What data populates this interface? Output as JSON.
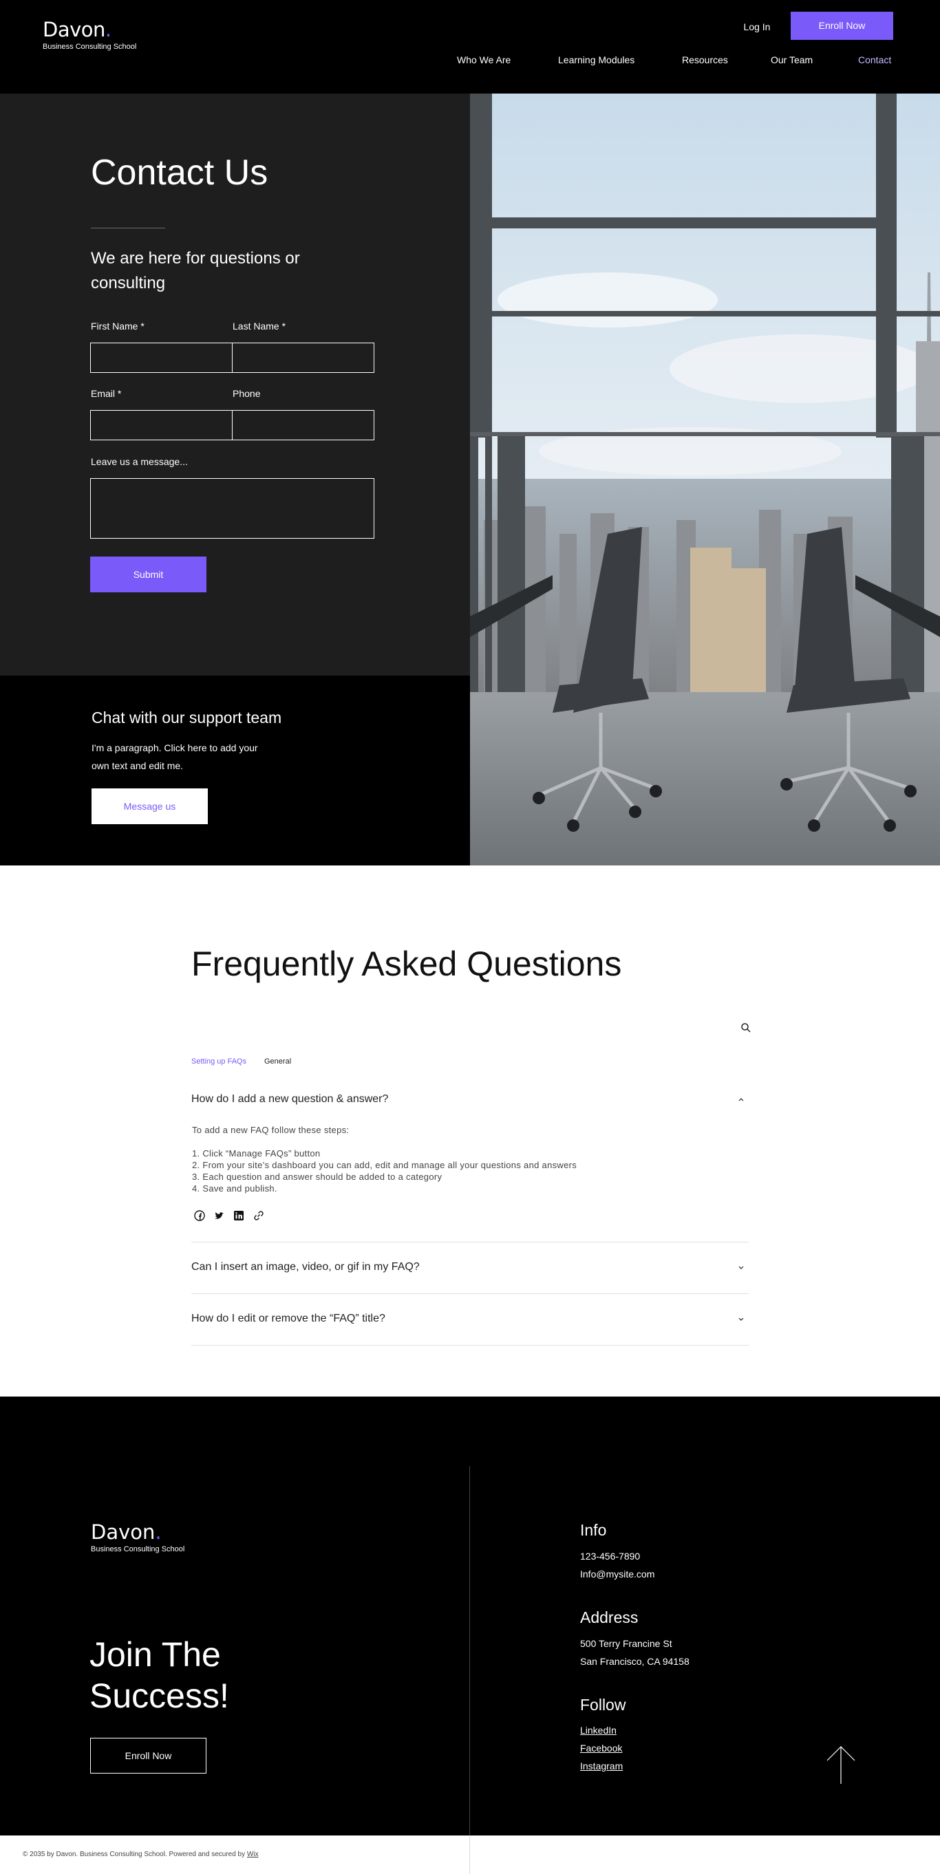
{
  "header": {
    "logo_name": "Davon",
    "logo_dot": ".",
    "logo_sub": "Business Consulting School",
    "login": "Log In",
    "enroll": "Enroll Now",
    "nav": [
      "Who We Are",
      "Learning Modules",
      "Resources",
      "Our Team",
      "Contact"
    ],
    "active_nav": "Contact"
  },
  "contact": {
    "title": "Contact Us",
    "subtitle": "We are here for questions or consulting",
    "first_name_label": "First Name *",
    "last_name_label": "Last Name *",
    "email_label": "Email *",
    "phone_label": "Phone",
    "message_label": "Leave us a message...",
    "submit": "Submit"
  },
  "chat": {
    "title": "Chat with our support team",
    "text": "I'm a paragraph. Click here to add your own text and edit me.",
    "button": "Message us"
  },
  "faq": {
    "title": "Frequently Asked Questions",
    "tabs": [
      "Setting up FAQs",
      "General"
    ],
    "active_tab": "Setting up FAQs",
    "questions": [
      "How do I add a new question & answer?",
      "Can I insert an image, video, or gif in my FAQ?",
      "How do I edit or remove the “FAQ” title?"
    ],
    "answer_intro": "To add a new FAQ follow these steps:",
    "answer_steps": [
      "1. Click “Manage FAQs” button",
      "2. From your site’s dashboard you can add, edit and manage all your questions and answers",
      "3. Each question and answer should be added to a category",
      "4. Save and publish."
    ]
  },
  "footer": {
    "logo_name": "Davon",
    "logo_dot": ".",
    "logo_sub": "Business Consulting School",
    "join": "Join The Success!",
    "enroll": "Enroll Now",
    "info_title": "Info",
    "phone": "123-456-7890",
    "email": "Info@mysite.com",
    "address_title": "Address",
    "address_line1": "500 Terry Francine St",
    "address_line2": "San Francisco, CA 94158",
    "follow_title": "Follow",
    "links": [
      "LinkedIn",
      "Facebook",
      "Instagram"
    ],
    "copyright": "© 2035 by Davon. Business Consulting School. Powered and secured by ",
    "wix": "Wix"
  },
  "colors": {
    "accent": "#7a5af8",
    "dark_panel": "#1e1e1e",
    "black": "#000000",
    "white": "#ffffff"
  }
}
